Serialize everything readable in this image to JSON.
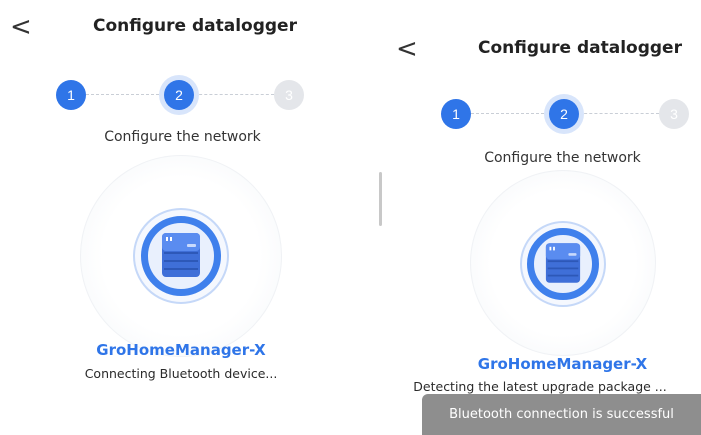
{
  "left_screen": {
    "title": "Configure datalogger",
    "back_glyph": "<",
    "steps": [
      {
        "label": "1",
        "state": "done"
      },
      {
        "label": "2",
        "state": "current"
      },
      {
        "label": "3",
        "state": "todo"
      }
    ],
    "step_caption": "Configure the network",
    "device_name": "GroHomeManager-X",
    "status": "Connecting Bluetooth device..."
  },
  "right_screen": {
    "title": "Configure datalogger",
    "back_glyph": "<",
    "steps": [
      {
        "label": "1",
        "state": "done"
      },
      {
        "label": "2",
        "state": "current"
      },
      {
        "label": "3",
        "state": "todo"
      }
    ],
    "step_caption": "Configure the network",
    "device_name": "GroHomeManager-X",
    "status": "Detecting the latest upgrade package ..."
  },
  "toast": {
    "message": "Bluetooth connection is successful"
  },
  "colors": {
    "accent": "#2f75e8",
    "step_inactive": "#e4e6ea",
    "toast_bg": "#8e8e8e",
    "text": "#2a2a2a"
  },
  "icons": {
    "back": "chevron-left-icon",
    "device": "datalogger-device-icon"
  }
}
